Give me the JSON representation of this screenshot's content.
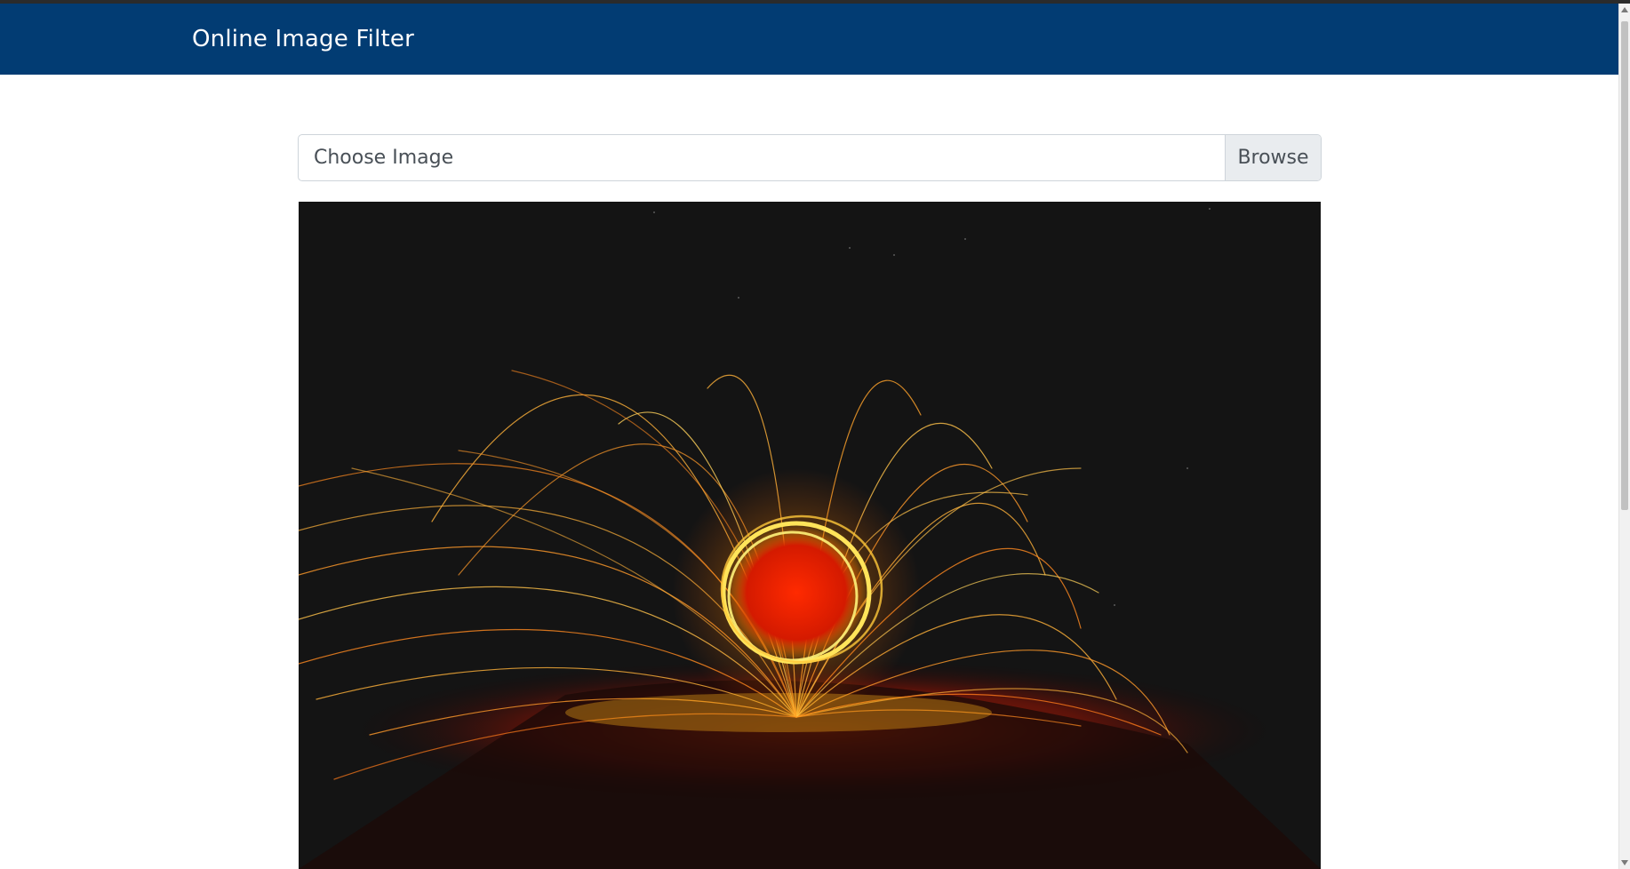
{
  "navbar": {
    "brand": "Online Image Filter",
    "background_color": "#023c73"
  },
  "file_input": {
    "label": "Choose Image",
    "browse_label": "Browse"
  },
  "preview": {
    "subject": "steel wool light painting with orange-yellow sparks on dark background"
  },
  "scrollbar": {
    "position_fraction": 0.0
  }
}
